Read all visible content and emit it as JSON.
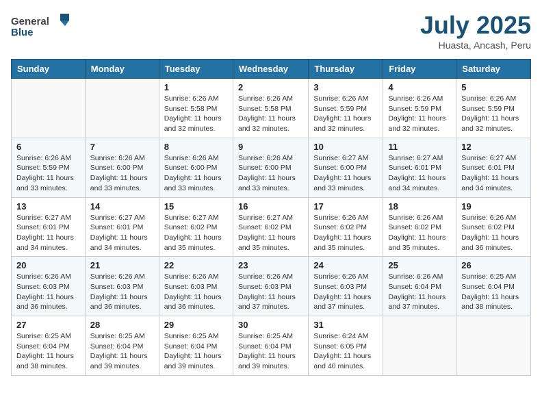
{
  "header": {
    "logo_general": "General",
    "logo_blue": "Blue",
    "month": "July 2025",
    "location": "Huasta, Ancash, Peru"
  },
  "days_of_week": [
    "Sunday",
    "Monday",
    "Tuesday",
    "Wednesday",
    "Thursday",
    "Friday",
    "Saturday"
  ],
  "weeks": [
    [
      {
        "day": "",
        "sunrise": "",
        "sunset": "",
        "daylight": ""
      },
      {
        "day": "",
        "sunrise": "",
        "sunset": "",
        "daylight": ""
      },
      {
        "day": "1",
        "sunrise": "Sunrise: 6:26 AM",
        "sunset": "Sunset: 5:58 PM",
        "daylight": "Daylight: 11 hours and 32 minutes."
      },
      {
        "day": "2",
        "sunrise": "Sunrise: 6:26 AM",
        "sunset": "Sunset: 5:58 PM",
        "daylight": "Daylight: 11 hours and 32 minutes."
      },
      {
        "day": "3",
        "sunrise": "Sunrise: 6:26 AM",
        "sunset": "Sunset: 5:59 PM",
        "daylight": "Daylight: 11 hours and 32 minutes."
      },
      {
        "day": "4",
        "sunrise": "Sunrise: 6:26 AM",
        "sunset": "Sunset: 5:59 PM",
        "daylight": "Daylight: 11 hours and 32 minutes."
      },
      {
        "day": "5",
        "sunrise": "Sunrise: 6:26 AM",
        "sunset": "Sunset: 5:59 PM",
        "daylight": "Daylight: 11 hours and 32 minutes."
      }
    ],
    [
      {
        "day": "6",
        "sunrise": "Sunrise: 6:26 AM",
        "sunset": "Sunset: 5:59 PM",
        "daylight": "Daylight: 11 hours and 33 minutes."
      },
      {
        "day": "7",
        "sunrise": "Sunrise: 6:26 AM",
        "sunset": "Sunset: 6:00 PM",
        "daylight": "Daylight: 11 hours and 33 minutes."
      },
      {
        "day": "8",
        "sunrise": "Sunrise: 6:26 AM",
        "sunset": "Sunset: 6:00 PM",
        "daylight": "Daylight: 11 hours and 33 minutes."
      },
      {
        "day": "9",
        "sunrise": "Sunrise: 6:26 AM",
        "sunset": "Sunset: 6:00 PM",
        "daylight": "Daylight: 11 hours and 33 minutes."
      },
      {
        "day": "10",
        "sunrise": "Sunrise: 6:27 AM",
        "sunset": "Sunset: 6:00 PM",
        "daylight": "Daylight: 11 hours and 33 minutes."
      },
      {
        "day": "11",
        "sunrise": "Sunrise: 6:27 AM",
        "sunset": "Sunset: 6:01 PM",
        "daylight": "Daylight: 11 hours and 34 minutes."
      },
      {
        "day": "12",
        "sunrise": "Sunrise: 6:27 AM",
        "sunset": "Sunset: 6:01 PM",
        "daylight": "Daylight: 11 hours and 34 minutes."
      }
    ],
    [
      {
        "day": "13",
        "sunrise": "Sunrise: 6:27 AM",
        "sunset": "Sunset: 6:01 PM",
        "daylight": "Daylight: 11 hours and 34 minutes."
      },
      {
        "day": "14",
        "sunrise": "Sunrise: 6:27 AM",
        "sunset": "Sunset: 6:01 PM",
        "daylight": "Daylight: 11 hours and 34 minutes."
      },
      {
        "day": "15",
        "sunrise": "Sunrise: 6:27 AM",
        "sunset": "Sunset: 6:02 PM",
        "daylight": "Daylight: 11 hours and 35 minutes."
      },
      {
        "day": "16",
        "sunrise": "Sunrise: 6:27 AM",
        "sunset": "Sunset: 6:02 PM",
        "daylight": "Daylight: 11 hours and 35 minutes."
      },
      {
        "day": "17",
        "sunrise": "Sunrise: 6:26 AM",
        "sunset": "Sunset: 6:02 PM",
        "daylight": "Daylight: 11 hours and 35 minutes."
      },
      {
        "day": "18",
        "sunrise": "Sunrise: 6:26 AM",
        "sunset": "Sunset: 6:02 PM",
        "daylight": "Daylight: 11 hours and 35 minutes."
      },
      {
        "day": "19",
        "sunrise": "Sunrise: 6:26 AM",
        "sunset": "Sunset: 6:02 PM",
        "daylight": "Daylight: 11 hours and 36 minutes."
      }
    ],
    [
      {
        "day": "20",
        "sunrise": "Sunrise: 6:26 AM",
        "sunset": "Sunset: 6:03 PM",
        "daylight": "Daylight: 11 hours and 36 minutes."
      },
      {
        "day": "21",
        "sunrise": "Sunrise: 6:26 AM",
        "sunset": "Sunset: 6:03 PM",
        "daylight": "Daylight: 11 hours and 36 minutes."
      },
      {
        "day": "22",
        "sunrise": "Sunrise: 6:26 AM",
        "sunset": "Sunset: 6:03 PM",
        "daylight": "Daylight: 11 hours and 36 minutes."
      },
      {
        "day": "23",
        "sunrise": "Sunrise: 6:26 AM",
        "sunset": "Sunset: 6:03 PM",
        "daylight": "Daylight: 11 hours and 37 minutes."
      },
      {
        "day": "24",
        "sunrise": "Sunrise: 6:26 AM",
        "sunset": "Sunset: 6:03 PM",
        "daylight": "Daylight: 11 hours and 37 minutes."
      },
      {
        "day": "25",
        "sunrise": "Sunrise: 6:26 AM",
        "sunset": "Sunset: 6:04 PM",
        "daylight": "Daylight: 11 hours and 37 minutes."
      },
      {
        "day": "26",
        "sunrise": "Sunrise: 6:25 AM",
        "sunset": "Sunset: 6:04 PM",
        "daylight": "Daylight: 11 hours and 38 minutes."
      }
    ],
    [
      {
        "day": "27",
        "sunrise": "Sunrise: 6:25 AM",
        "sunset": "Sunset: 6:04 PM",
        "daylight": "Daylight: 11 hours and 38 minutes."
      },
      {
        "day": "28",
        "sunrise": "Sunrise: 6:25 AM",
        "sunset": "Sunset: 6:04 PM",
        "daylight": "Daylight: 11 hours and 39 minutes."
      },
      {
        "day": "29",
        "sunrise": "Sunrise: 6:25 AM",
        "sunset": "Sunset: 6:04 PM",
        "daylight": "Daylight: 11 hours and 39 minutes."
      },
      {
        "day": "30",
        "sunrise": "Sunrise: 6:25 AM",
        "sunset": "Sunset: 6:04 PM",
        "daylight": "Daylight: 11 hours and 39 minutes."
      },
      {
        "day": "31",
        "sunrise": "Sunrise: 6:24 AM",
        "sunset": "Sunset: 6:05 PM",
        "daylight": "Daylight: 11 hours and 40 minutes."
      },
      {
        "day": "",
        "sunrise": "",
        "sunset": "",
        "daylight": ""
      },
      {
        "day": "",
        "sunrise": "",
        "sunset": "",
        "daylight": ""
      }
    ]
  ]
}
